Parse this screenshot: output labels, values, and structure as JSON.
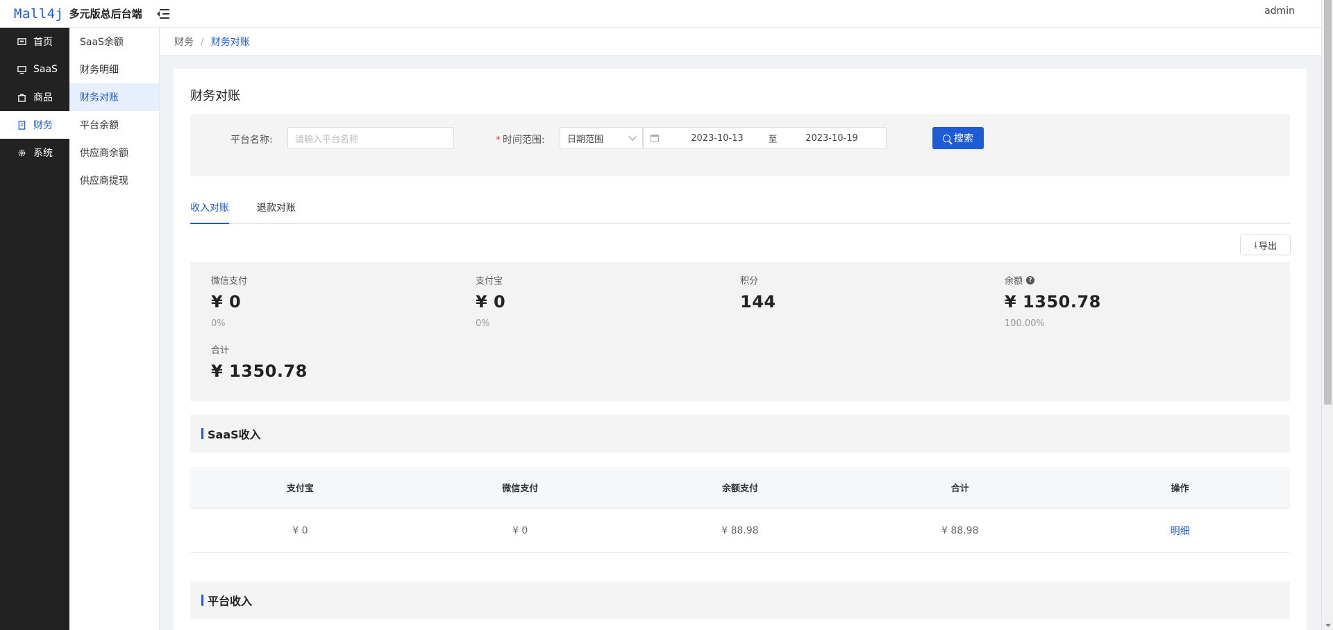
{
  "header": {
    "logo_text": "Mall4j",
    "app_title": "多元版总后台端",
    "user": "admin"
  },
  "nav": {
    "items": [
      {
        "label": "首页",
        "icon": "home-icon"
      },
      {
        "label": "SaaS",
        "icon": "monitor-icon"
      },
      {
        "label": "商品",
        "icon": "bag-icon"
      },
      {
        "label": "财务",
        "icon": "document-icon",
        "active": true
      },
      {
        "label": "系统",
        "icon": "gear-icon"
      }
    ]
  },
  "submenu": {
    "items": [
      {
        "label": "SaaS余额"
      },
      {
        "label": "财务明细"
      },
      {
        "label": "财务对账",
        "active": true
      },
      {
        "label": "平台余额"
      },
      {
        "label": "供应商余额"
      },
      {
        "label": "供应商提现"
      }
    ]
  },
  "breadcrumb": {
    "root": "财务",
    "sep": "/",
    "current": "财务对账"
  },
  "page": {
    "title": "财务对账"
  },
  "filters": {
    "platform_label": "平台名称:",
    "platform_placeholder": "请输入平台名称",
    "required_mark": "*",
    "time_label": "时间范围:",
    "range_type": "日期范围",
    "start_date": "2023-10-13",
    "range_sep": "至",
    "end_date": "2023-10-19",
    "search_label": "搜索"
  },
  "tabs": [
    {
      "label": "收入对账",
      "active": true
    },
    {
      "label": "退款对账"
    }
  ],
  "export_label": "导出",
  "stats": {
    "wechat": {
      "name": "微信支付",
      "value": "¥ 0",
      "percent": "0%"
    },
    "alipay": {
      "name": "支付宝",
      "value": "¥ 0",
      "percent": "0%"
    },
    "points": {
      "name": "积分",
      "value": "144"
    },
    "balance": {
      "name": "余额",
      "value": "¥ 1350.78",
      "percent": "100.00%",
      "help": "?"
    },
    "total": {
      "name": "合计",
      "value": "¥ 1350.78"
    }
  },
  "saas_section": {
    "title": "SaaS收入",
    "columns": [
      "支付宝",
      "微信支付",
      "余额支付",
      "合计",
      "操作"
    ],
    "row": {
      "alipay": "¥ 0",
      "wechat": "¥ 0",
      "balance": "¥ 88.98",
      "total": "¥ 88.98",
      "action": "明细"
    }
  },
  "platform_section": {
    "title": "平台收入"
  },
  "colors": {
    "accent": "#1e5bd6",
    "sidebar_bg": "#222222"
  }
}
